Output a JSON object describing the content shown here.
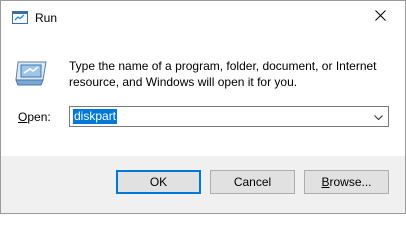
{
  "window": {
    "title": "Run",
    "icon": "run-app-icon",
    "close_icon": "close-icon"
  },
  "content": {
    "icon": "run-dialog-icon",
    "description": "Type the name of a program, folder, document, or Internet resource, and Windows will open it for you.",
    "open_label_mnemonic": "O",
    "open_label_rest": "pen:",
    "open_value": "diskpart",
    "dropdown_icon": "chevron-down-icon"
  },
  "buttons": {
    "ok": "OK",
    "cancel": "Cancel",
    "browse_mnemonic": "B",
    "browse_rest": "rowse..."
  },
  "colors": {
    "selection": "#0078d7",
    "footer_bg": "#f0f0f0",
    "button_bg": "#e1e1e1"
  }
}
